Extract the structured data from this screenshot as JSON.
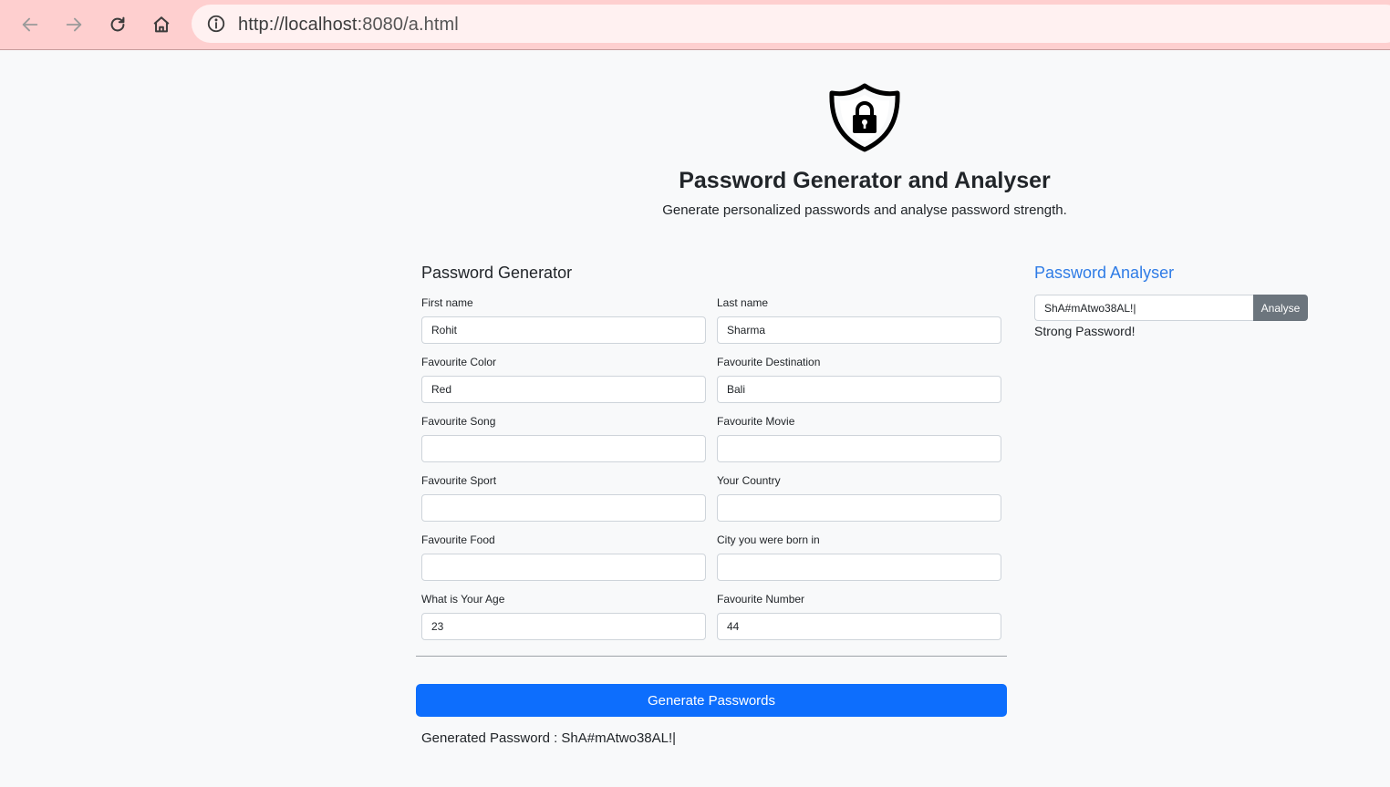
{
  "browser": {
    "url_host": "http://localhost",
    "url_rest": ":8080/a.html",
    "icons": [
      "back-arrow-icon",
      "forward-arrow-icon",
      "reload-icon",
      "home-icon",
      "info-icon"
    ]
  },
  "header": {
    "title": "Password Generator and Analyser",
    "subtitle": "Generate personalized passwords and analyse password strength.",
    "logo_icon": "shield-lock-icon"
  },
  "generator": {
    "heading": "Password Generator",
    "fields": {
      "first_name": {
        "label": "First name",
        "value": "Rohit"
      },
      "last_name": {
        "label": "Last name",
        "value": "Sharma"
      },
      "fav_color": {
        "label": "Favourite Color",
        "value": "Red"
      },
      "fav_destination": {
        "label": "Favourite Destination",
        "value": "Bali"
      },
      "fav_song": {
        "label": "Favourite Song",
        "value": ""
      },
      "fav_movie": {
        "label": "Favourite Movie",
        "value": ""
      },
      "fav_sport": {
        "label": "Favourite Sport",
        "value": ""
      },
      "country": {
        "label": "Your Country",
        "value": ""
      },
      "fav_food": {
        "label": "Favourite Food",
        "value": ""
      },
      "birth_city": {
        "label": "City you were born in",
        "value": ""
      },
      "age": {
        "label": "What is Your Age",
        "value": "23"
      },
      "fav_number": {
        "label": "Favourite Number",
        "value": "44"
      }
    },
    "button_label": "Generate Passwords",
    "result_text": "Generated Password : ShA#mAtwo38AL!|"
  },
  "analyser": {
    "heading": "Password Analyser",
    "input_value": "ShA#mAtwo38AL!|",
    "button_label": "Analyse",
    "result_text": "Strong Password!"
  },
  "colors": {
    "toolbar": "#fecfcf",
    "omnibox": "#fff1f1",
    "primary": "#0d6efd",
    "secondary": "#6c757d",
    "analyser_heading": "#2f7ce6",
    "page_bg": "#f8f9fa"
  }
}
